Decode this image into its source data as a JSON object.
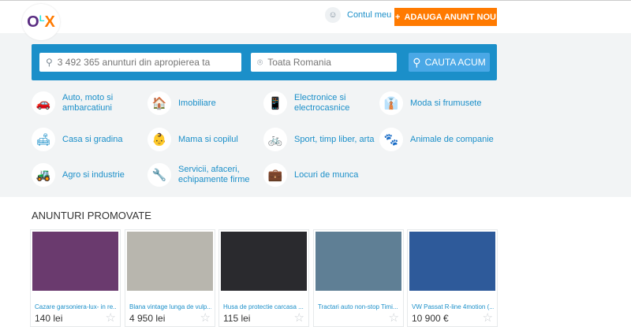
{
  "header": {
    "logo": "OLX",
    "account_label": "Contul meu",
    "post_button": "ADAUGA ANUNT NOU",
    "post_icon": "plus-icon"
  },
  "search": {
    "query_placeholder": "3 492 365 anunturi din apropierea ta",
    "location_placeholder": "Toata Romania",
    "button": "CAUTA ACUM"
  },
  "categories": [
    {
      "label": "Auto, moto si ambarcatiuni",
      "icon": "car-icon",
      "glyph": "🚗"
    },
    {
      "label": "Imobiliare",
      "icon": "house-icon",
      "glyph": "🏠"
    },
    {
      "label": "Electronice si electrocasnice",
      "icon": "phone-icon",
      "glyph": "📱"
    },
    {
      "label": "Moda si frumusete",
      "icon": "shirt-icon",
      "glyph": "👔"
    },
    {
      "label": "Casa si gradina",
      "icon": "sofa-icon",
      "glyph": "🛋"
    },
    {
      "label": "Mama si copilul",
      "icon": "stroller-icon",
      "glyph": "👶"
    },
    {
      "label": "Sport, timp liber, arta",
      "icon": "bicycle-icon",
      "glyph": "🚲"
    },
    {
      "label": "Animale de companie",
      "icon": "paw-icon",
      "glyph": "🐾"
    },
    {
      "label": "Agro si industrie",
      "icon": "tractor-icon",
      "glyph": "🚜"
    },
    {
      "label": "Servicii, afaceri, echipamente firme",
      "icon": "wrench-icon",
      "glyph": "🔧"
    },
    {
      "label": "Locuri de munca",
      "icon": "briefcase-icon",
      "glyph": "💼"
    }
  ],
  "promoted": {
    "title": "ANUNTURI PROMOVATE",
    "items": [
      {
        "title": "Cazare garsoniera-lux- in re...",
        "price": "140 lei",
        "color": "#6a3a6e"
      },
      {
        "title": "Blana vintage lunga de vulp...",
        "price": "4 950 lei",
        "color": "#b8b6ae"
      },
      {
        "title": "Husa de protectie carcasa ...",
        "price": "115 lei",
        "color": "#2a2a2e"
      },
      {
        "title": "Tractari auto non-stop Timi...",
        "price": "",
        "color": "#5f7f95"
      },
      {
        "title": "VW Passat R-line 4motion (...",
        "price": "10 900 €",
        "color": "#2e5a9a"
      }
    ]
  }
}
